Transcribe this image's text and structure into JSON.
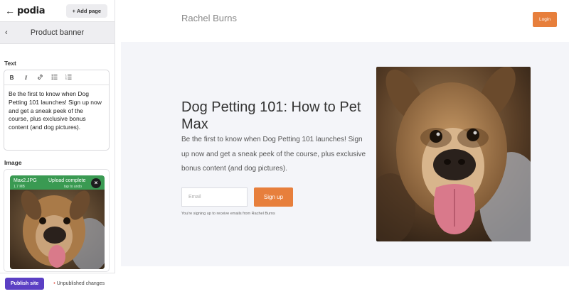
{
  "sidebar": {
    "logo": "podia",
    "add_page_label": "+ Add page",
    "panel_title": "Product banner",
    "text_label": "Text",
    "image_label": "Image",
    "editor_content": "Be the first to know when Dog Petting 101 launches! Sign up now and get a sneak peek of the course, plus exclusive bonus content (and dog pictures).",
    "toolbar": {
      "bold": "B",
      "italic": "I"
    },
    "upload": {
      "file_name": "Max2.JPG",
      "file_size": "1.7 MB",
      "status": "Upload complete",
      "undo": "tap to undo"
    },
    "footer": {
      "publish_label": "Publish site",
      "unpublished_label": "Unpublished changes"
    }
  },
  "preview": {
    "site_name": "Rachel Burns",
    "login_label": "Login",
    "headline": "Dog Petting 101: How to Pet Max",
    "subtext": "Be the first to know when Dog Petting 101 launches! Sign up now and get a sneak peek of the course, plus exclusive bonus content (and dog pictures).",
    "email_placeholder": "Email",
    "signup_label": "Sign up",
    "disclaimer": "You're signing up to receive emails from Rachel Burns"
  },
  "colors": {
    "accent_orange": "#e77f3c",
    "publish_purple": "#5b3fc4",
    "upload_green": "#3a9a52",
    "unpublished_dot": "#e0493a"
  },
  "icons": [
    "back-arrow-icon",
    "chevron-left-icon",
    "bold-icon",
    "italic-icon",
    "link-icon",
    "bulleted-list-icon",
    "numbered-list-icon",
    "close-icon"
  ]
}
